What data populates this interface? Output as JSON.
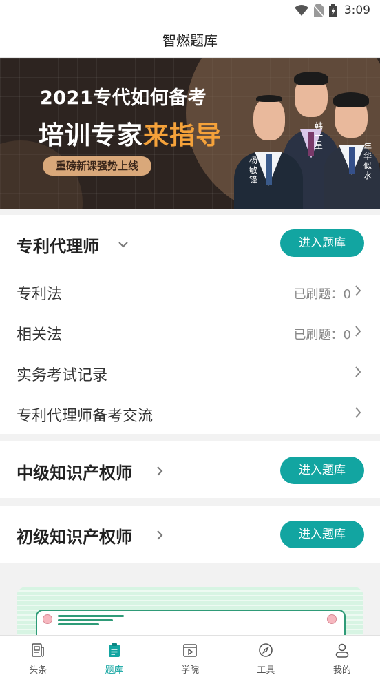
{
  "status": {
    "time": "3:09"
  },
  "appbar": {
    "title": "智燃题库"
  },
  "banner": {
    "line1": "2021专代如何备考",
    "line2_main": "培训专家",
    "line2_highlight": "来指导",
    "pill": "重磅新课强势上线",
    "people": [
      "杨敏锋",
      "韩一星",
      "年华似水"
    ]
  },
  "sections": [
    {
      "title": "专利代理师",
      "button": "进入题库",
      "rows": [
        {
          "label": "专利法",
          "meta": "已刷题：0"
        },
        {
          "label": "相关法",
          "meta": "已刷题：0"
        },
        {
          "label": "实务考试记录",
          "meta": ""
        },
        {
          "label": "专利代理师备考交流",
          "meta": ""
        }
      ]
    },
    {
      "title": "中级知识产权师",
      "button": "进入题库"
    },
    {
      "title": "初级知识产权师",
      "button": "进入题库"
    }
  ],
  "tabs": [
    {
      "label": "头条",
      "icon": "news-icon"
    },
    {
      "label": "题库",
      "icon": "question-bank-icon"
    },
    {
      "label": "学院",
      "icon": "video-icon"
    },
    {
      "label": "工具",
      "icon": "compass-icon"
    },
    {
      "label": "我的",
      "icon": "profile-icon"
    }
  ],
  "colors": {
    "accent": "#12a5a1",
    "banner_highlight": "#f5a23a",
    "promo_bg": "#d7f4e3"
  }
}
